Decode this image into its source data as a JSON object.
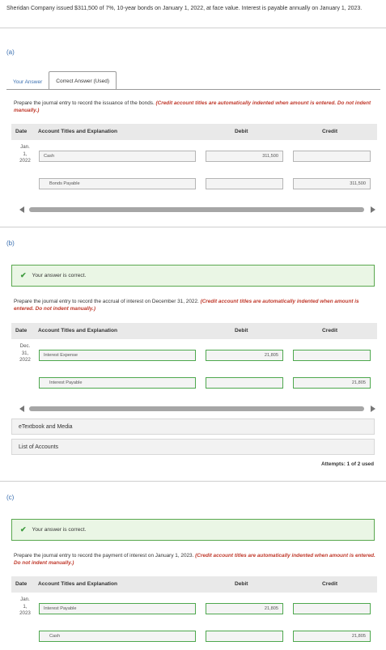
{
  "problem_text": "Sheridan Company issued $311,500 of 7%, 10-year bonds on January 1, 2022, at face value. Interest is payable annually on January 1, 2023.",
  "partA": {
    "label": "(a)",
    "tabs": [
      "Your Answer",
      "Correct Answer (Used)"
    ],
    "instruction": "Prepare the journal entry to record the issuance of the bonds.",
    "note": "(Credit account titles are automatically indented when amount is entered. Do not indent manually.)",
    "date": [
      "Jan.",
      "1,",
      "2022"
    ],
    "rows": [
      {
        "account": "Cash",
        "debit": "311,500",
        "credit": ""
      },
      {
        "account": "Bonds Payable",
        "debit": "",
        "credit": "311,500"
      }
    ]
  },
  "partB": {
    "label": "(b)",
    "correct_msg": "Your answer is correct.",
    "instruction": "Prepare the journal entry to record the accrual of interest on December 31, 2022.",
    "note": "(Credit account titles are automatically indented when amount is entered. Do not indent manually.)",
    "date": [
      "Dec.",
      "31,",
      "2022"
    ],
    "rows": [
      {
        "account": "Interest Expense",
        "debit": "21,805",
        "credit": ""
      },
      {
        "account": "Interest Payable",
        "debit": "",
        "credit": "21,805"
      }
    ],
    "etextbook": "eTextbook and Media",
    "accounts_list": "List of Accounts",
    "attempts": "Attempts: 1 of 2 used"
  },
  "partC": {
    "label": "(c)",
    "correct_msg": "Your answer is correct.",
    "instruction": "Prepare the journal entry to record the payment of interest on January 1, 2023.",
    "note": "(Credit account titles are automatically indented when amount is entered. Do not indent manually.)",
    "date": [
      "Jan.",
      "1,",
      "2023"
    ],
    "rows": [
      {
        "account": "Interest Payable",
        "debit": "21,805",
        "credit": ""
      },
      {
        "account": "Cash",
        "debit": "",
        "credit": "21,805"
      }
    ]
  },
  "table_headers": {
    "date": "Date",
    "account": "Account Titles and Explanation",
    "debit": "Debit",
    "credit": "Credit"
  },
  "colors": {
    "accent": "#3a6fb0",
    "correct_bg": "#eaf6e5",
    "correct_border": "#5aa84f",
    "note_red": "#c0392b"
  }
}
